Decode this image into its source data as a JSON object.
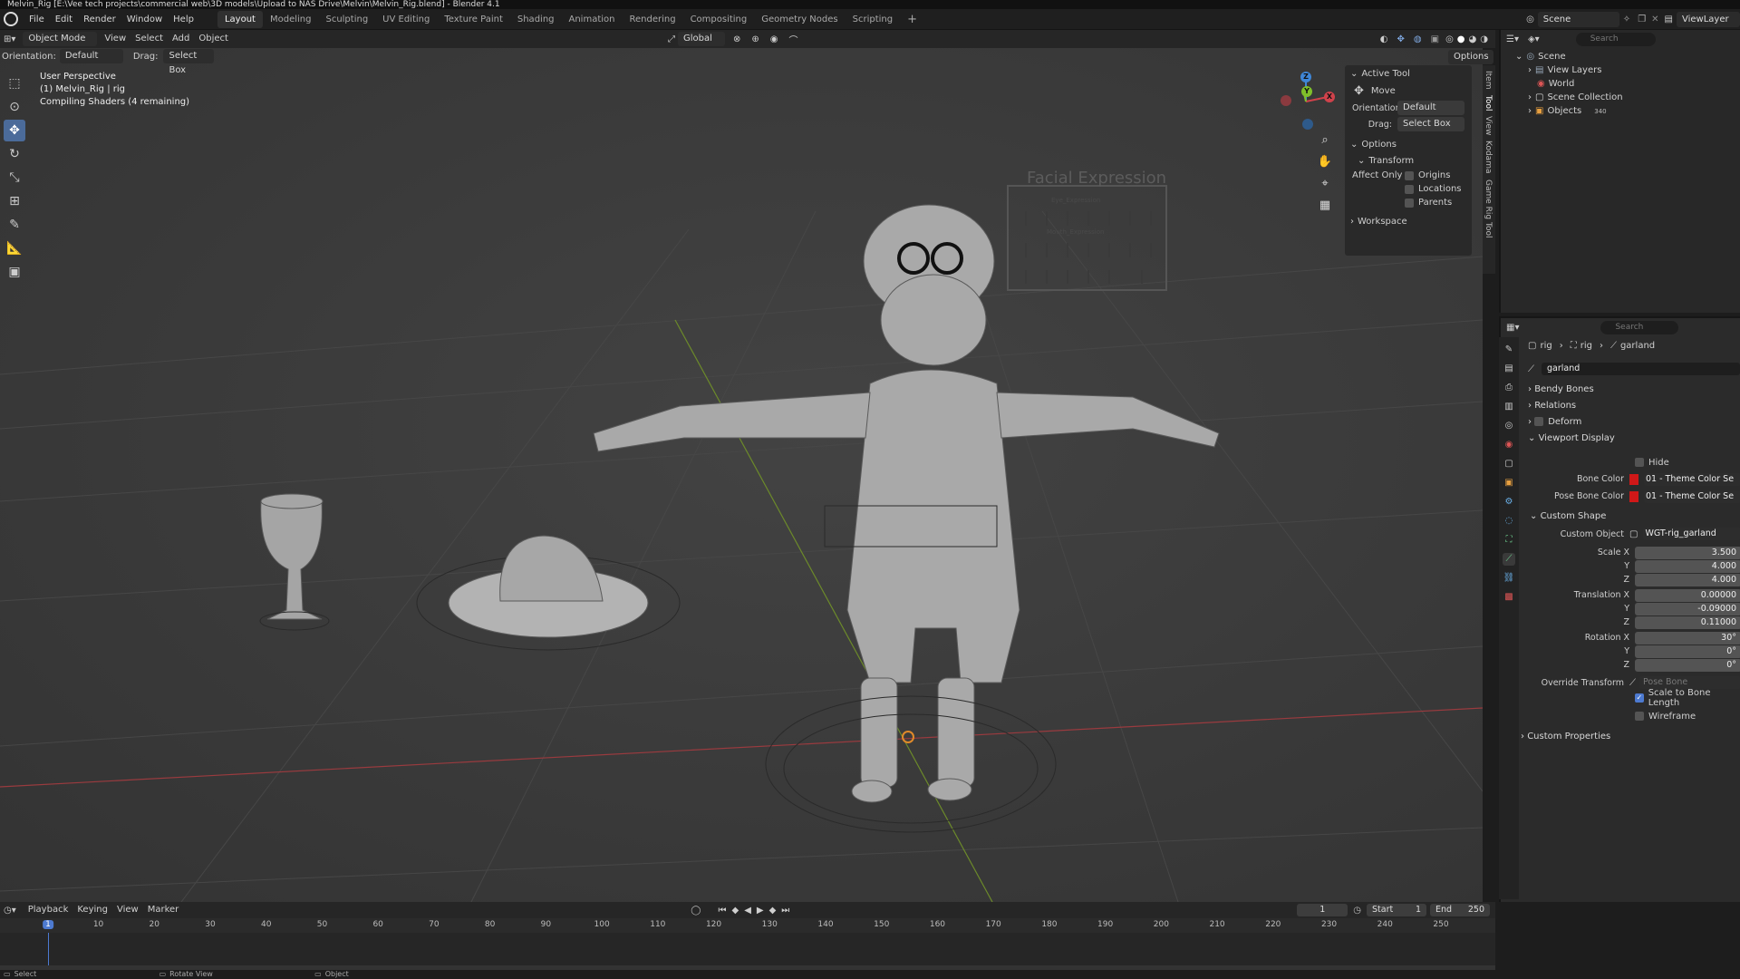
{
  "window_title": "Melvin_Rig [E:\\Vee tech projects\\commercial web\\3D models\\Upload to NAS Drive\\Melvin\\Melvin_Rig.blend] - Blender 4.1",
  "menu": [
    "File",
    "Edit",
    "Render",
    "Window",
    "Help"
  ],
  "workspaces": [
    "Layout",
    "Modeling",
    "Sculpting",
    "UV Editing",
    "Texture Paint",
    "Shading",
    "Animation",
    "Rendering",
    "Compositing",
    "Geometry Nodes",
    "Scripting"
  ],
  "active_workspace": "Layout",
  "add_workspace": "+",
  "scene_name": "Scene",
  "view_layer": "ViewLayer",
  "viewport_header": {
    "mode": "Object Mode",
    "menus": [
      "View",
      "Select",
      "Add",
      "Object"
    ],
    "transform_orientation": "Global",
    "options": "Options"
  },
  "tool_settings": {
    "orientation_label": "Orientation:",
    "orientation_value": "Default",
    "drag_label": "Drag:",
    "drag_value": "Select Box"
  },
  "viewport_info": {
    "line1": "User Perspective",
    "line2": "(1) Melvin_Rig | rig",
    "line3": "Compiling Shaders (4 remaining)"
  },
  "n_panel": {
    "tabs": [
      "Item",
      "Tool",
      "View",
      "Kodama",
      "Game Rig Tool"
    ],
    "active_tool_title": "Active Tool",
    "tool_name": "Move",
    "orientation_label": "Orientation",
    "orientation_value": "Default",
    "drag_label": "Drag:",
    "drag_value": "Select Box",
    "options_title": "Options",
    "transform_title": "Transform",
    "affect_only_label": "Affect Only",
    "affect_only": [
      "Origins",
      "Locations",
      "Parents"
    ],
    "workspace_title": "Workspace"
  },
  "viewport_scene_text": {
    "board_title": "Facial Expression",
    "eye_expression": "Eye_Expression",
    "mouth_expression": "Mouth_Expression",
    "eye_labels": [
      "Smile",
      "Angry",
      "Sad",
      "Surprise",
      "Fear",
      "Disgust",
      "Cry"
    ],
    "mouth_labels": [
      "Smile",
      "Angry",
      "Sad",
      "Surprise",
      "Fear",
      "Disgust",
      "Cry"
    ],
    "phoneme_labels": [
      "Close",
      "CornSmile",
      "Kiss",
      "A",
      "E",
      "O",
      "Blink_R/L"
    ]
  },
  "gizmo": {
    "x": "X",
    "y": "Y",
    "z": "Z"
  },
  "outliner": {
    "search_placeholder": "Search",
    "items": [
      {
        "label": "Scene",
        "indent": 0
      },
      {
        "label": "View Layers",
        "indent": 1
      },
      {
        "label": "World",
        "indent": 1
      },
      {
        "label": "Scene Collection",
        "indent": 1
      },
      {
        "label": "Objects",
        "indent": 1
      }
    ],
    "objects_count": "340"
  },
  "properties": {
    "search_placeholder": "Search",
    "breadcrumb": [
      "rig",
      "rig",
      "garland"
    ],
    "bone_name": "garland",
    "sections_collapsed": [
      "Bendy Bones",
      "Relations",
      "Deform"
    ],
    "viewport_display_title": "Viewport Display",
    "hide_label": "Hide",
    "bone_color_label": "Bone Color",
    "bone_color_value": "01 - Theme Color Se",
    "pose_bone_color_label": "Pose Bone Color",
    "pose_bone_color_value": "01 - Theme Color Se",
    "custom_shape_title": "Custom Shape",
    "custom_object_label": "Custom Object",
    "custom_object_value": "WGT-rig_garland",
    "scale_x_label": "Scale X",
    "scale_x": "3.500",
    "scale_y_label": "Y",
    "scale_y": "4.000",
    "scale_z_label": "Z",
    "scale_z": "4.000",
    "trans_x_label": "Translation X",
    "trans_x": "0.00000",
    "trans_y_label": "Y",
    "trans_y": "-0.09000",
    "trans_z_label": "Z",
    "trans_z": "0.11000",
    "rot_x_label": "Rotation X",
    "rot_x": "30°",
    "rot_y_label": "Y",
    "rot_y": "0°",
    "rot_z_label": "Z",
    "rot_z": "0°",
    "override_label": "Override Transform",
    "override_placeholder": "Pose Bone",
    "scale_bone_length": "Scale to Bone Length",
    "wireframe": "Wireframe",
    "custom_props_title": "Custom Properties",
    "bone_color_swatch": "#d01818"
  },
  "timeline": {
    "menus": [
      "Playback",
      "Keying",
      "View",
      "Marker"
    ],
    "current_frame": "1",
    "start_label": "Start",
    "start": "1",
    "end_label": "End",
    "end": "250",
    "ticks": [
      "1",
      "10",
      "20",
      "30",
      "40",
      "50",
      "60",
      "70",
      "80",
      "90",
      "100",
      "110",
      "120",
      "130",
      "140",
      "150",
      "160",
      "170",
      "180",
      "190",
      "200",
      "210",
      "220",
      "230",
      "240",
      "250"
    ]
  },
  "statusbar": [
    "Select",
    "Rotate View",
    "Object"
  ],
  "colors": {
    "accent": "#4b6b9a",
    "x_axis": "#d0424b",
    "y_axis": "#7fbf2a",
    "z_axis": "#3f86d6",
    "playhead": "#4d7ad0"
  }
}
